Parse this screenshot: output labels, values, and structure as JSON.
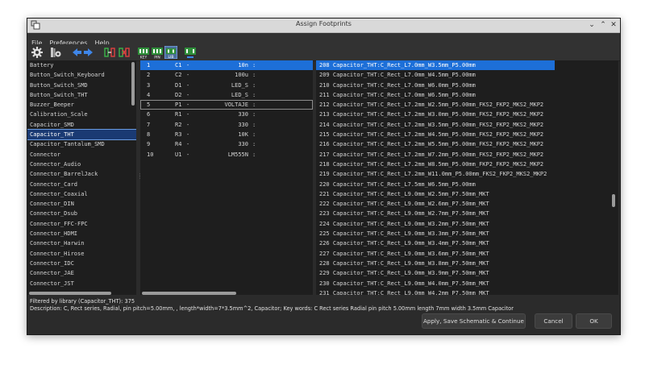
{
  "window": {
    "title": "Assign Footprints"
  },
  "menu": [
    "File",
    "Preferences",
    "Help"
  ],
  "toolbar": [
    "settings-icon",
    "library-manager-icon",
    "arrow-left-icon",
    "arrow-right-icon",
    "associate-icon",
    "delete-association-icon",
    "filter-by-keywords-icon",
    "filter-by-pin-count-icon",
    "filter-by-library-icon",
    "show-footprint-icon"
  ],
  "libraries": {
    "items": [
      "Battery",
      "Button_Switch_Keyboard",
      "Button_Switch_SMD",
      "Button_Switch_THT",
      "Buzzer_Beeper",
      "Calibration_Scale",
      "Capacitor_SMD",
      "Capacitor_THT",
      "Capacitor_Tantalum_SMD",
      "Connector",
      "Connector_Audio",
      "Connector_BarrelJack",
      "Connector_Card",
      "Connector_Coaxial",
      "Connector_DIN",
      "Connector_Dsub",
      "Connector_FFC-FPC",
      "Connector_HDMI",
      "Connector_Harwin",
      "Connector_Hirose",
      "Connector_IDC",
      "Connector_JAE",
      "Connector_JST"
    ],
    "selected_index": 7
  },
  "components": {
    "rows": [
      {
        "idx": "1",
        "ref": "C1",
        "sep": "-",
        "value": "10n",
        "colon": ":"
      },
      {
        "idx": "2",
        "ref": "C2",
        "sep": "-",
        "value": "100u",
        "colon": ":"
      },
      {
        "idx": "3",
        "ref": "D1",
        "sep": "-",
        "value": "LED_S",
        "colon": ":"
      },
      {
        "idx": "4",
        "ref": "D2",
        "sep": "-",
        "value": "LED_S",
        "colon": ":"
      },
      {
        "idx": "5",
        "ref": "P1",
        "sep": "-",
        "value": "VOLTAJE",
        "colon": ":"
      },
      {
        "idx": "6",
        "ref": "R1",
        "sep": "-",
        "value": "330",
        "colon": ":"
      },
      {
        "idx": "7",
        "ref": "R2",
        "sep": "-",
        "value": "330",
        "colon": ":"
      },
      {
        "idx": "8",
        "ref": "R3",
        "sep": "-",
        "value": "10K",
        "colon": ":"
      },
      {
        "idx": "9",
        "ref": "R4",
        "sep": "-",
        "value": "330",
        "colon": ":"
      },
      {
        "idx": "10",
        "ref": "U1",
        "sep": "-",
        "value": "LM555N",
        "colon": ":"
      }
    ],
    "selected_index": 0,
    "focused_index": 4
  },
  "footprints": {
    "items": [
      "208 Capacitor_THT:C_Rect_L7.0mm_W3.5mm_P5.00mm",
      "209 Capacitor_THT:C_Rect_L7.0mm_W4.5mm_P5.00mm",
      "210 Capacitor_THT:C_Rect_L7.0mm_W6.0mm_P5.00mm",
      "211 Capacitor_THT:C_Rect_L7.0mm_W6.5mm_P5.00mm",
      "212 Capacitor_THT:C_Rect_L7.2mm_W2.5mm_P5.00mm_FKS2_FKP2_MKS2_MKP2",
      "213 Capacitor_THT:C_Rect_L7.2mm_W3.0mm_P5.00mm_FKS2_FKP2_MKS2_MKP2",
      "214 Capacitor_THT:C_Rect_L7.2mm_W3.5mm_P5.00mm_FKS2_FKP2_MKS2_MKP2",
      "215 Capacitor_THT:C_Rect_L7.2mm_W4.5mm_P5.00mm_FKS2_FKP2_MKS2_MKP2",
      "216 Capacitor_THT:C_Rect_L7.2mm_W5.5mm_P5.00mm_FKS2_FKP2_MKS2_MKP2",
      "217 Capacitor_THT:C_Rect_L7.2mm_W7.2mm_P5.00mm_FKS2_FKP2_MKS2_MKP2",
      "218 Capacitor_THT:C_Rect_L7.2mm_W8.5mm_P5.00mm_FKP2_FKP2_MKS2_MKP2",
      "219 Capacitor_THT:C_Rect_L7.2mm_W11.0mm_P5.00mm_FKS2_FKP2_MKS2_MKP2",
      "220 Capacitor_THT:C_Rect_L7.5mm_W6.5mm_P5.00mm",
      "221 Capacitor_THT:C_Rect_L9.0mm_W2.5mm_P7.50mm_MKT",
      "222 Capacitor_THT:C_Rect_L9.0mm_W2.6mm_P7.50mm_MKT",
      "223 Capacitor_THT:C_Rect_L9.0mm_W2.7mm_P7.50mm_MKT",
      "224 Capacitor_THT:C_Rect_L9.0mm_W3.2mm_P7.50mm_MKT",
      "225 Capacitor_THT:C_Rect_L9.0mm_W3.3mm_P7.50mm_MKT",
      "226 Capacitor_THT:C_Rect_L9.0mm_W3.4mm_P7.50mm_MKT",
      "227 Capacitor_THT:C_Rect_L9.0mm_W3.6mm_P7.50mm_MKT",
      "228 Capacitor_THT:C_Rect_L9.0mm_W3.8mm_P7.50mm_MKT",
      "229 Capacitor_THT:C_Rect_L9.0mm_W3.9mm_P7.50mm_MKT",
      "230 Capacitor_THT:C_Rect_L9.0mm_W4.0mm_P7.50mm_MKT",
      "231 Capacitor_THT:C_Rect_L9.0mm_W4.2mm_P7.50mm_MKT"
    ],
    "selected_index": 0
  },
  "status": {
    "filter": "Filtered by library (Capacitor_THT): 375",
    "description": "Description: C, Rect series, Radial, pin pitch=5.00mm, , length*width=7*3.5mm^2, Capacitor;  Key words: C Rect series Radial pin pitch 5.00mm  length 7mm width 3.5mm Capacitor"
  },
  "buttons": {
    "apply": "Apply, Save Schematic & Continue",
    "cancel": "Cancel",
    "ok": "OK"
  }
}
